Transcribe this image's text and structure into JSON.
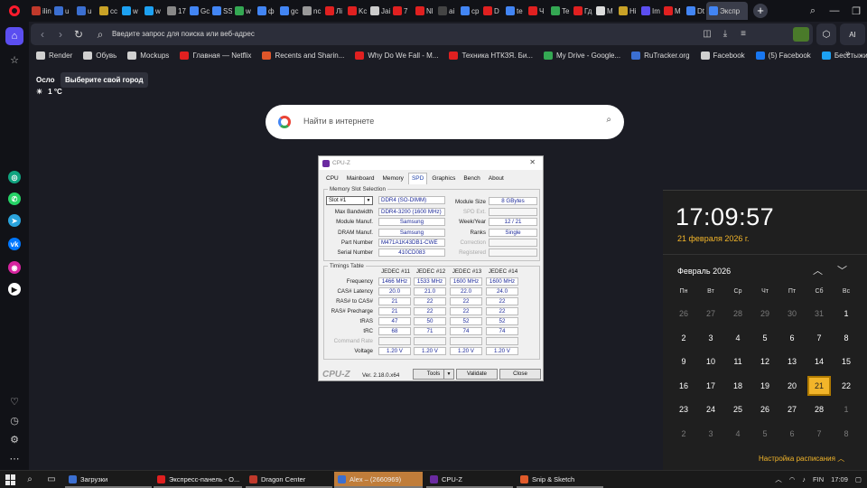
{
  "browser": {
    "tabs": [
      {
        "label": "ilin",
        "color": "#c0392b"
      },
      {
        "label": "u",
        "color": "#3b6fd1"
      },
      {
        "label": "u",
        "color": "#3b6fd1"
      },
      {
        "label": "cc",
        "color": "#c9a227"
      },
      {
        "label": "w",
        "color": "#1da1f2"
      },
      {
        "label": "w",
        "color": "#1da1f2"
      },
      {
        "label": "17",
        "color": "#888888"
      },
      {
        "label": "Gc",
        "color": "#4285f4"
      },
      {
        "label": "SS",
        "color": "#4285f4"
      },
      {
        "label": "w",
        "color": "#34a853"
      },
      {
        "label": "ф",
        "color": "#4285f4"
      },
      {
        "label": "gc",
        "color": "#4285f4"
      },
      {
        "label": "nc",
        "color": "#999999"
      },
      {
        "label": "Лi",
        "color": "#e02020"
      },
      {
        "label": "Kc",
        "color": "#e02020"
      },
      {
        "label": "Jai",
        "color": "#cccccc"
      },
      {
        "label": "7",
        "color": "#e02020"
      },
      {
        "label": "Nl",
        "color": "#e02020"
      },
      {
        "label": "ai",
        "color": "#444444"
      },
      {
        "label": "cp",
        "color": "#4285f4"
      },
      {
        "label": "D",
        "color": "#e02020"
      },
      {
        "label": "te",
        "color": "#4285f4"
      },
      {
        "label": "Ч",
        "color": "#e02020"
      },
      {
        "label": "Te",
        "color": "#34a853"
      },
      {
        "label": "Гд",
        "color": "#e02020"
      },
      {
        "label": "M",
        "color": "#dddddd"
      },
      {
        "label": "Hi",
        "color": "#c9a227"
      },
      {
        "label": "Im",
        "color": "#5b4ef0"
      },
      {
        "label": "M",
        "color": "#e02020"
      },
      {
        "label": "Dt",
        "color": "#4285f4"
      },
      {
        "label": "Экспр",
        "color": "#4285f4",
        "active": true
      }
    ],
    "new_tab": "+",
    "address_placeholder": "Введите запрос для поиска или веб-адрес",
    "ai_label": "AI",
    "bookmarks": [
      {
        "label": "Render",
        "color": "#d0d0d0"
      },
      {
        "label": "Обувь",
        "color": "#d0d0d0"
      },
      {
        "label": "Mockups",
        "color": "#d0d0d0"
      },
      {
        "label": "Главная — Netflix",
        "color": "#e02020"
      },
      {
        "label": "Recents and Sharin...",
        "color": "#e0562a"
      },
      {
        "label": "Why Do We Fall - M...",
        "color": "#e02020"
      },
      {
        "label": "Техника НТКЗЯ. Би...",
        "color": "#e02020"
      },
      {
        "label": "My Drive - Google...",
        "color": "#34a853"
      },
      {
        "label": "RuTracker.org",
        "color": "#3b6fd1"
      },
      {
        "label": "Facebook",
        "color": "#d0d0d0"
      },
      {
        "label": "(5) Facebook",
        "color": "#1877f2"
      },
      {
        "label": "Бесстыжие - 8 сезо...",
        "color": "#1da1f2"
      }
    ]
  },
  "weather": {
    "city": "Осло",
    "tooltip": "Выберите свой город",
    "temperature": "1 °C"
  },
  "google_search": {
    "placeholder": "Найти в интернете"
  },
  "cpuz": {
    "title": "CPU-Z",
    "tabs": [
      "CPU",
      "Mainboard",
      "Memory",
      "SPD",
      "Graphics",
      "Bench",
      "About"
    ],
    "active_tab": "SPD",
    "memory_slot_group": "Memory Slot Selection",
    "slot": "Slot #1",
    "module_type": "DDR4 (SO-DIMM)",
    "max_bandwidth_label": "Max Bandwidth",
    "max_bandwidth": "DDR4-3200 (1600 MHz)",
    "module_manuf_label": "Module Manuf.",
    "module_manuf": "Samsung",
    "dram_manuf_label": "DRAM Manuf.",
    "dram_manuf": "Samsung",
    "part_number_label": "Part Number",
    "part_number": "M471A1K43DB1-CWE",
    "serial_number_label": "Serial Number",
    "serial_number": "410CD083",
    "module_size_label": "Module Size",
    "module_size": "8 GBytes",
    "spd_ext_label": "SPD Ext.",
    "week_year_label": "Week/Year",
    "week_year": "12 / 21",
    "ranks_label": "Ranks",
    "ranks": "Single",
    "correction_label": "Correction",
    "registered_label": "Registered",
    "timings_group": "Timings Table",
    "timing_columns": [
      "JEDEC #11",
      "JEDEC #12",
      "JEDEC #13",
      "JEDEC #14"
    ],
    "timing_rows": [
      {
        "label": "Frequency",
        "values": [
          "1466 MHz",
          "1533 MHz",
          "1600 MHz",
          "1600 MHz"
        ]
      },
      {
        "label": "CAS# Latency",
        "values": [
          "20.0",
          "21.0",
          "22.0",
          "24.0"
        ]
      },
      {
        "label": "RAS# to CAS#",
        "values": [
          "21",
          "22",
          "22",
          "22"
        ]
      },
      {
        "label": "RAS# Precharge",
        "values": [
          "21",
          "22",
          "22",
          "22"
        ]
      },
      {
        "label": "tRAS",
        "values": [
          "47",
          "50",
          "52",
          "52"
        ]
      },
      {
        "label": "tRC",
        "values": [
          "68",
          "71",
          "74",
          "74"
        ]
      },
      {
        "label": "Command Rate",
        "values": [
          "",
          "",
          "",
          ""
        ],
        "dim": true
      },
      {
        "label": "Voltage",
        "values": [
          "1.20 V",
          "1.20 V",
          "1.20 V",
          "1.20 V"
        ]
      }
    ],
    "logo": "CPU-Z",
    "version": "Ver. 2.18.0.x64",
    "tools_label": "Tools",
    "validate_label": "Validate",
    "close_label": "Close"
  },
  "clock": {
    "time": "17:09:57",
    "date": "21 февраля 2026 г.",
    "month": "Февраль 2026",
    "weekdays": [
      "Пн",
      "Вт",
      "Ср",
      "Чт",
      "Пт",
      "Сб",
      "Вс"
    ],
    "days": [
      [
        "26",
        "27",
        "28",
        "29",
        "30",
        "31",
        "1"
      ],
      [
        "2",
        "3",
        "4",
        "5",
        "6",
        "7",
        "8"
      ],
      [
        "9",
        "10",
        "11",
        "12",
        "13",
        "14",
        "15"
      ],
      [
        "16",
        "17",
        "18",
        "19",
        "20",
        "21",
        "22"
      ],
      [
        "23",
        "24",
        "25",
        "26",
        "27",
        "28",
        "1"
      ],
      [
        "2",
        "3",
        "4",
        "5",
        "6",
        "7",
        "8"
      ]
    ],
    "today": "21",
    "schedule_label": "Настройка расписания"
  },
  "taskbar": {
    "apps": [
      {
        "label": "Загрузки",
        "color": "#3b6fd1"
      },
      {
        "label": "Экспресс-панель - О...",
        "color": "#e02020"
      },
      {
        "label": "Dragon Center",
        "color": "#c0392b"
      },
      {
        "label": "Alex – (2660969)",
        "color": "#3b6fd1",
        "active": true
      },
      {
        "label": "CPU-Z",
        "color": "#6a2aa0"
      },
      {
        "label": "Snip & Sketch",
        "color": "#e05a2a"
      }
    ],
    "language": "FIN",
    "time": "17:09"
  }
}
